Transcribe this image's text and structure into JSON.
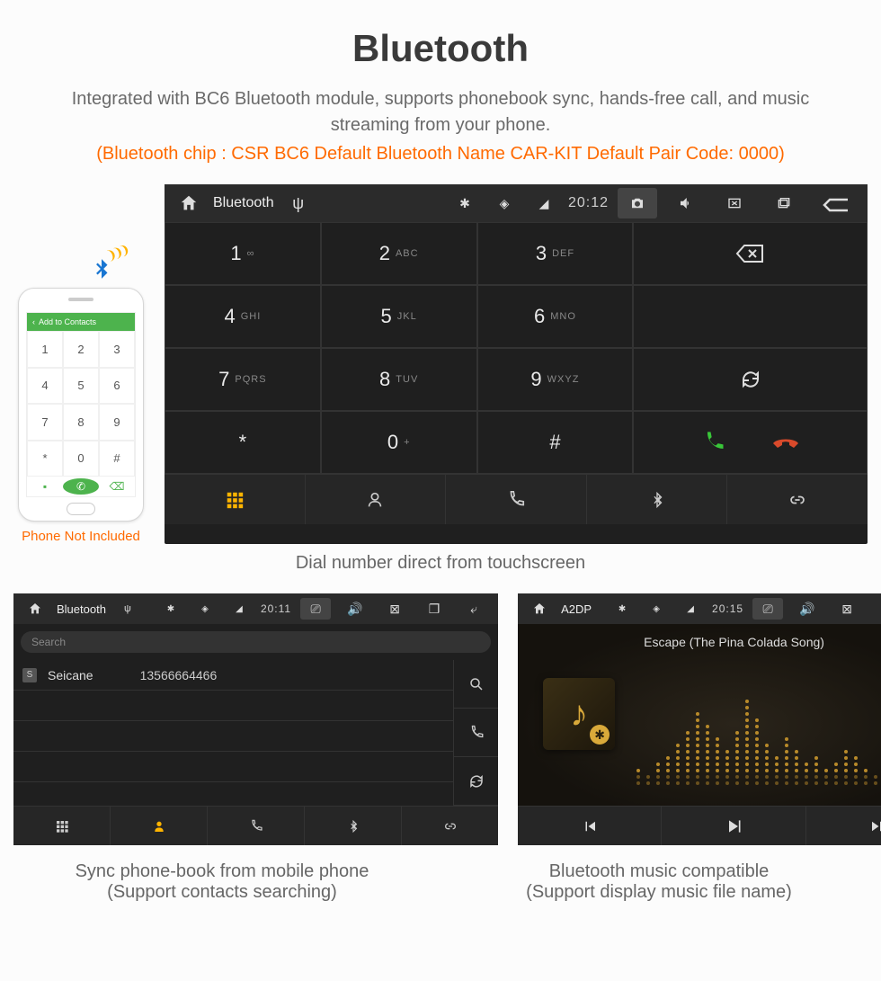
{
  "header": {
    "title": "Bluetooth",
    "subtitle": "Integrated with BC6 Bluetooth module, supports phonebook sync, hands-free call, and music streaming from your phone.",
    "specline": "(Bluetooth chip : CSR BC6    Default Bluetooth Name CAR-KIT    Default Pair Code: 0000)"
  },
  "phone": {
    "topbar": "Add to Contacts",
    "keys": [
      "1",
      "2",
      "3",
      "4",
      "5",
      "6",
      "7",
      "8",
      "9",
      "*",
      "0",
      "#"
    ],
    "caption": "Phone Not Included"
  },
  "dialer": {
    "status": {
      "title": "Bluetooth",
      "time": "20:12"
    },
    "keys": [
      {
        "n": "1",
        "s": "∞"
      },
      {
        "n": "2",
        "s": "ABC"
      },
      {
        "n": "3",
        "s": "DEF"
      },
      {
        "n": "4",
        "s": "GHI"
      },
      {
        "n": "5",
        "s": "JKL"
      },
      {
        "n": "6",
        "s": "MNO"
      },
      {
        "n": "7",
        "s": "PQRS"
      },
      {
        "n": "8",
        "s": "TUV"
      },
      {
        "n": "9",
        "s": "WXYZ"
      },
      {
        "n": "*",
        "s": ""
      },
      {
        "n": "0",
        "s": "+"
      },
      {
        "n": "#",
        "s": ""
      }
    ],
    "caption": "Dial number direct from touchscreen"
  },
  "contacts": {
    "status": {
      "title": "Bluetooth",
      "time": "20:11"
    },
    "search_placeholder": "Search",
    "row": {
      "badge": "S",
      "name": "Seicane",
      "number": "13566664466"
    },
    "caption_line1": "Sync phone-book from mobile phone",
    "caption_line2": "(Support contacts searching)"
  },
  "music": {
    "status": {
      "title": "A2DP",
      "time": "20:15"
    },
    "song": "Escape (The Pina Colada Song)",
    "caption_line1": "Bluetooth music compatible",
    "caption_line2": "(Support display music file name)"
  }
}
